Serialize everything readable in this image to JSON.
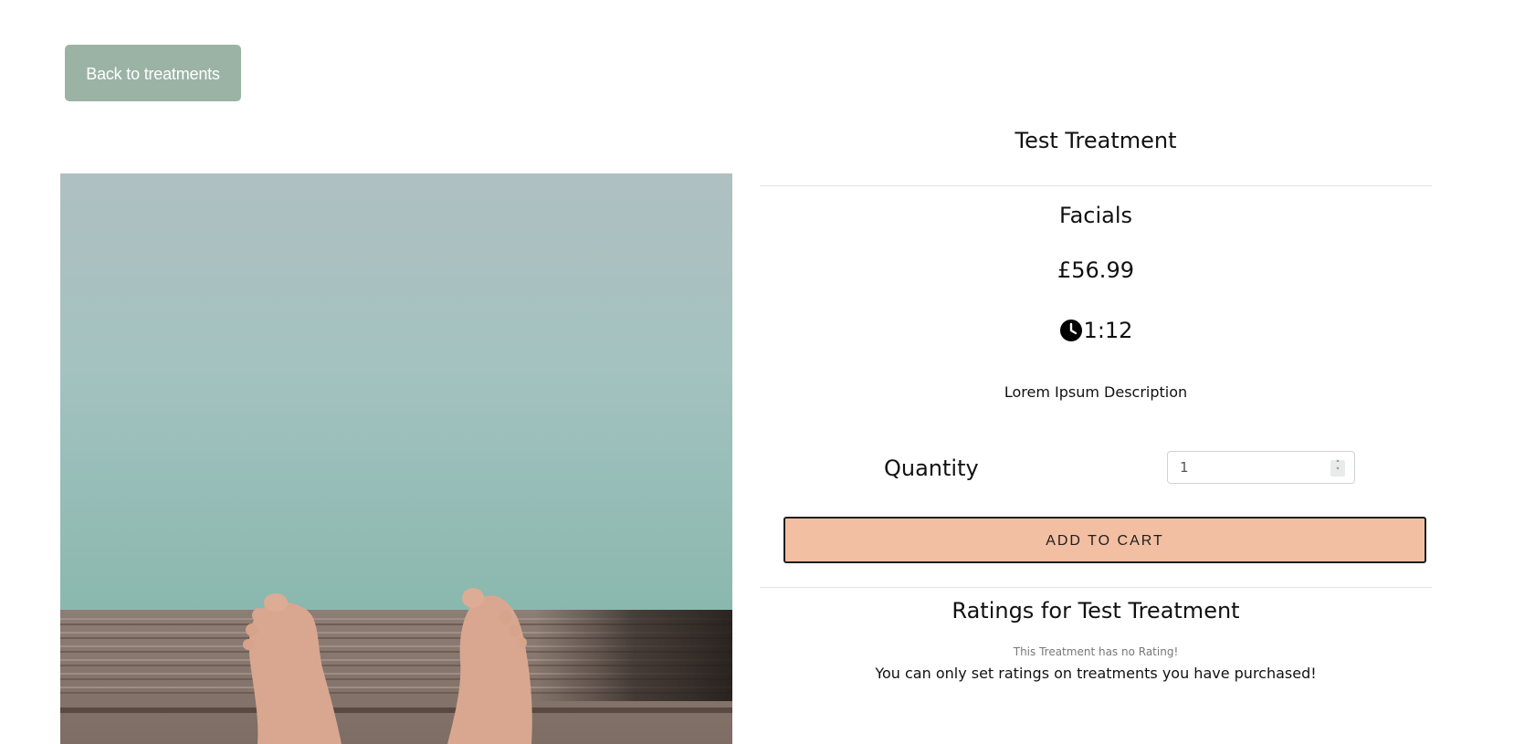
{
  "navigation": {
    "back_label": "Back to treatments"
  },
  "treatment": {
    "title": "Test Treatment",
    "category": "Facials",
    "price": "£56.99",
    "duration": "1:12",
    "description": "Lorem Ipsum Description",
    "image_subject": "bare feet on wooden jetty above turquoise water"
  },
  "purchase": {
    "quantity_label": "Quantity",
    "quantity_value": "1",
    "add_to_cart_label": "ADD TO CART"
  },
  "ratings": {
    "title": "Ratings for Test Treatment",
    "empty_text": "This Treatment has no Rating!",
    "purchase_note": "You can only set ratings on treatments you have purchased!"
  },
  "icons": {
    "duration_icon": "clock-icon"
  },
  "colors": {
    "back_button_bg": "#9bb3a4",
    "add_to_cart_bg": "#f2bfa2",
    "divider": "#e1e4e2"
  }
}
